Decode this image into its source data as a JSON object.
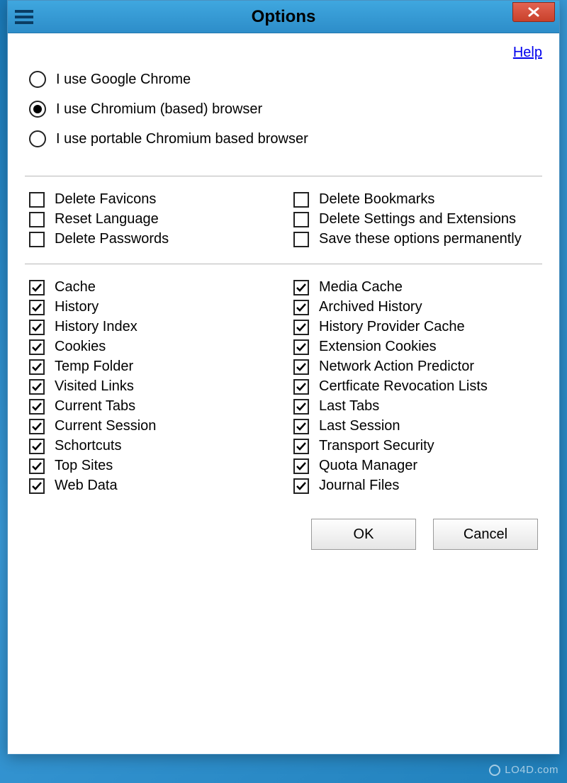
{
  "window": {
    "title": "Options"
  },
  "help_link": "Help",
  "browser_choice": {
    "options": [
      {
        "id": "chrome",
        "label": "I use Google Chrome",
        "selected": false
      },
      {
        "id": "chromium",
        "label": "I use Chromium (based) browser",
        "selected": true
      },
      {
        "id": "portable",
        "label": "I use portable Chromium based browser",
        "selected": false
      }
    ]
  },
  "delete_options": {
    "left": [
      {
        "id": "favicons",
        "label": "Delete Favicons",
        "checked": false
      },
      {
        "id": "language",
        "label": "Reset Language",
        "checked": false
      },
      {
        "id": "passwords",
        "label": "Delete Passwords",
        "checked": false
      }
    ],
    "right": [
      {
        "id": "bookmarks",
        "label": "Delete Bookmarks",
        "checked": false
      },
      {
        "id": "settings_ext",
        "label": "Delete Settings and Extensions",
        "checked": false
      },
      {
        "id": "save_perm",
        "label": "Save these options permanently",
        "checked": false
      }
    ]
  },
  "data_items": {
    "left": [
      {
        "id": "cache",
        "label": "Cache",
        "checked": true
      },
      {
        "id": "history",
        "label": "History",
        "checked": true
      },
      {
        "id": "history_index",
        "label": "History Index",
        "checked": true
      },
      {
        "id": "cookies",
        "label": "Cookies",
        "checked": true
      },
      {
        "id": "temp_folder",
        "label": "Temp Folder",
        "checked": true
      },
      {
        "id": "visited_links",
        "label": "Visited Links",
        "checked": true
      },
      {
        "id": "current_tabs",
        "label": "Current Tabs",
        "checked": true
      },
      {
        "id": "current_session",
        "label": "Current Session",
        "checked": true
      },
      {
        "id": "shortcuts",
        "label": "Schortcuts",
        "checked": true
      },
      {
        "id": "top_sites",
        "label": "Top Sites",
        "checked": true
      },
      {
        "id": "web_data",
        "label": "Web Data",
        "checked": true
      }
    ],
    "right": [
      {
        "id": "media_cache",
        "label": "Media Cache",
        "checked": true
      },
      {
        "id": "archived_history",
        "label": "Archived History",
        "checked": true
      },
      {
        "id": "history_provider_cache",
        "label": "History Provider Cache",
        "checked": true
      },
      {
        "id": "extension_cookies",
        "label": "Extension Cookies",
        "checked": true
      },
      {
        "id": "network_action_predictor",
        "label": "Network Action Predictor",
        "checked": true
      },
      {
        "id": "cert_revocation",
        "label": "Certficate Revocation Lists",
        "checked": true
      },
      {
        "id": "last_tabs",
        "label": "Last Tabs",
        "checked": true
      },
      {
        "id": "last_session",
        "label": "Last Session",
        "checked": true
      },
      {
        "id": "transport_security",
        "label": "Transport Security",
        "checked": true
      },
      {
        "id": "quota_manager",
        "label": "Quota Manager",
        "checked": true
      },
      {
        "id": "journal_files",
        "label": "Journal Files",
        "checked": true
      }
    ]
  },
  "buttons": {
    "ok": "OK",
    "cancel": "Cancel"
  },
  "watermark": "LO4D.com"
}
